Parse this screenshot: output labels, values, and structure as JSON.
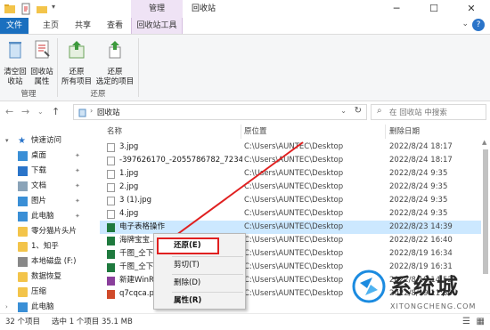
{
  "window": {
    "title": "回收站",
    "context_tab_header": "管理"
  },
  "ribbon_tabs": {
    "file": "文件",
    "home": "主页",
    "share": "共享",
    "view": "查看",
    "recycle_tools": "回收站工具"
  },
  "ribbon": {
    "manage_group": {
      "label": "管理",
      "empty_bin": "清空回\n收站",
      "properties": "回收站\n属性"
    },
    "restore_group": {
      "label": "还原",
      "restore_all": "还原\n所有项目",
      "restore_selected": "还原\n选定的项目"
    }
  },
  "address": {
    "path": "回收站",
    "search_placeholder": "在 回收站 中搜索"
  },
  "nav": {
    "items": [
      {
        "label": "快速访问",
        "icon": "star-icon",
        "pinned": false,
        "indent": 0
      },
      {
        "label": "桌面",
        "icon": "desktop-icon",
        "pinned": true,
        "indent": 1
      },
      {
        "label": "下载",
        "icon": "download-icon",
        "pinned": true,
        "indent": 1
      },
      {
        "label": "文档",
        "icon": "document-icon",
        "pinned": true,
        "indent": 1
      },
      {
        "label": "图片",
        "icon": "picture-icon",
        "pinned": true,
        "indent": 1
      },
      {
        "label": "此电脑",
        "icon": "computer-icon",
        "pinned": true,
        "indent": 1
      },
      {
        "label": "零分猫片头片",
        "icon": "folder-icon",
        "pinned": false,
        "indent": 1
      },
      {
        "label": "1、知乎",
        "icon": "folder-icon",
        "pinned": false,
        "indent": 1
      },
      {
        "label": "本地磁盘 (F:)",
        "icon": "drive-icon",
        "pinned": false,
        "indent": 1
      },
      {
        "label": "数据恢复",
        "icon": "folder-icon",
        "pinned": false,
        "indent": 1
      },
      {
        "label": "压缩",
        "icon": "folder-icon",
        "pinned": false,
        "indent": 1
      },
      {
        "label": "此电脑",
        "icon": "computer-icon",
        "pinned": false,
        "indent": 0
      }
    ]
  },
  "filelist": {
    "columns": {
      "name": "名称",
      "location": "原位置",
      "deleted": "删除日期"
    },
    "rows": [
      {
        "name": "3.jpg",
        "location": "C:\\Users\\AUNTEC\\Desktop",
        "deleted": "2022/8/24 18:17",
        "type": "image"
      },
      {
        "name": "-397626170_-2055786782_7234...",
        "location": "C:\\Users\\AUNTEC\\Desktop",
        "deleted": "2022/8/24 18:17",
        "type": "image"
      },
      {
        "name": "1.jpg",
        "location": "C:\\Users\\AUNTEC\\Desktop",
        "deleted": "2022/8/24 9:35",
        "type": "image"
      },
      {
        "name": "2.jpg",
        "location": "C:\\Users\\AUNTEC\\Desktop",
        "deleted": "2022/8/24 9:35",
        "type": "image"
      },
      {
        "name": "3 (1).jpg",
        "location": "C:\\Users\\AUNTEC\\Desktop",
        "deleted": "2022/8/24 9:35",
        "type": "image"
      },
      {
        "name": "4.jpg",
        "location": "C:\\Users\\AUNTEC\\Desktop",
        "deleted": "2022/8/24 9:35",
        "type": "image"
      },
      {
        "name": "电子表格操作",
        "location": "C:\\Users\\AUNTEC\\Desktop",
        "deleted": "2022/8/23 14:39",
        "type": "excel"
      },
      {
        "name": "海牌宝宝...",
        "location": "C:\\Users\\AUNTEC\\Desktop",
        "deleted": "2022/8/22 16:40",
        "type": "excel"
      },
      {
        "name": "千图_仝下...",
        "location": "C:\\Users\\AUNTEC\\Desktop",
        "deleted": "2022/8/19 16:34",
        "type": "excel"
      },
      {
        "name": "千图_仝下...",
        "location": "C:\\Users\\AUNTEC\\Desktop",
        "deleted": "2022/8/19 16:31",
        "type": "excel"
      },
      {
        "name": "新建WinRA...",
        "location": "C:\\Users\\AUNTEC\\Desktop",
        "deleted": "2022/8/19 14:52",
        "type": "archive"
      },
      {
        "name": "q7cqca.pp...",
        "location": "C:\\Users\\AUNTEC\\Desktop",
        "deleted": "2022/8/19 11:30",
        "type": "ppt"
      }
    ]
  },
  "context_menu": {
    "restore": "还原(E)",
    "cut": "剪切(T)",
    "delete": "删除(D)",
    "properties": "属性(R)"
  },
  "status": {
    "count": "32 个项目",
    "selection": "选中 1 个项目  35.1 MB"
  },
  "watermark": {
    "text": "系统城",
    "url": "XITONGCHENG.COM"
  },
  "colors": {
    "accent": "#1a6fbf",
    "context_tab": "#efe3f5",
    "selection": "#cce8ff",
    "highlight_red": "#e02020"
  }
}
